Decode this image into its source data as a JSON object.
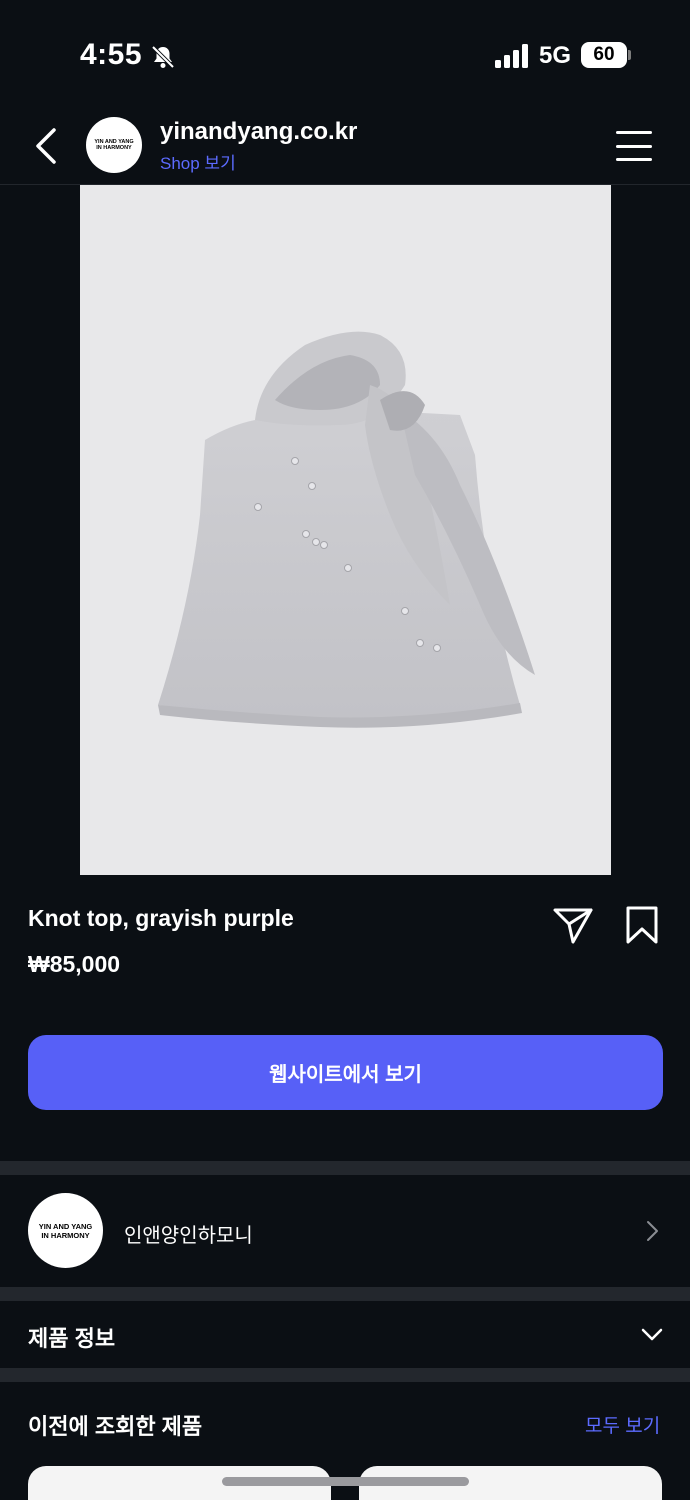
{
  "status_bar": {
    "time": "4:55",
    "network": "5G",
    "battery": "60"
  },
  "header": {
    "title": "yinandyang.co.kr",
    "subtitle": "Shop 보기",
    "avatar_logo": "YIN AND YANG IN HARMONY"
  },
  "product": {
    "title": "Knot top, grayish purple",
    "price": "₩85,000",
    "cta_label": "웹사이트에서 보기"
  },
  "shop": {
    "name": "인앤양인하모니",
    "logo_text": "YIN AND YANG IN HARMONY"
  },
  "product_info": {
    "label": "제품 정보"
  },
  "recently_viewed": {
    "title": "이전에 조회한 제품",
    "see_all": "모두 보기"
  },
  "colors": {
    "background": "#0b0f14",
    "accent": "#5760f7",
    "link": "#5c6bff",
    "divider": "#23272d",
    "image_bg": "#e8e8ea"
  },
  "icons": [
    "bell-slash-icon",
    "signal-icon",
    "back-chevron-icon",
    "menu-icon",
    "share-icon",
    "bookmark-icon",
    "chevron-right-icon",
    "chevron-down-icon"
  ]
}
